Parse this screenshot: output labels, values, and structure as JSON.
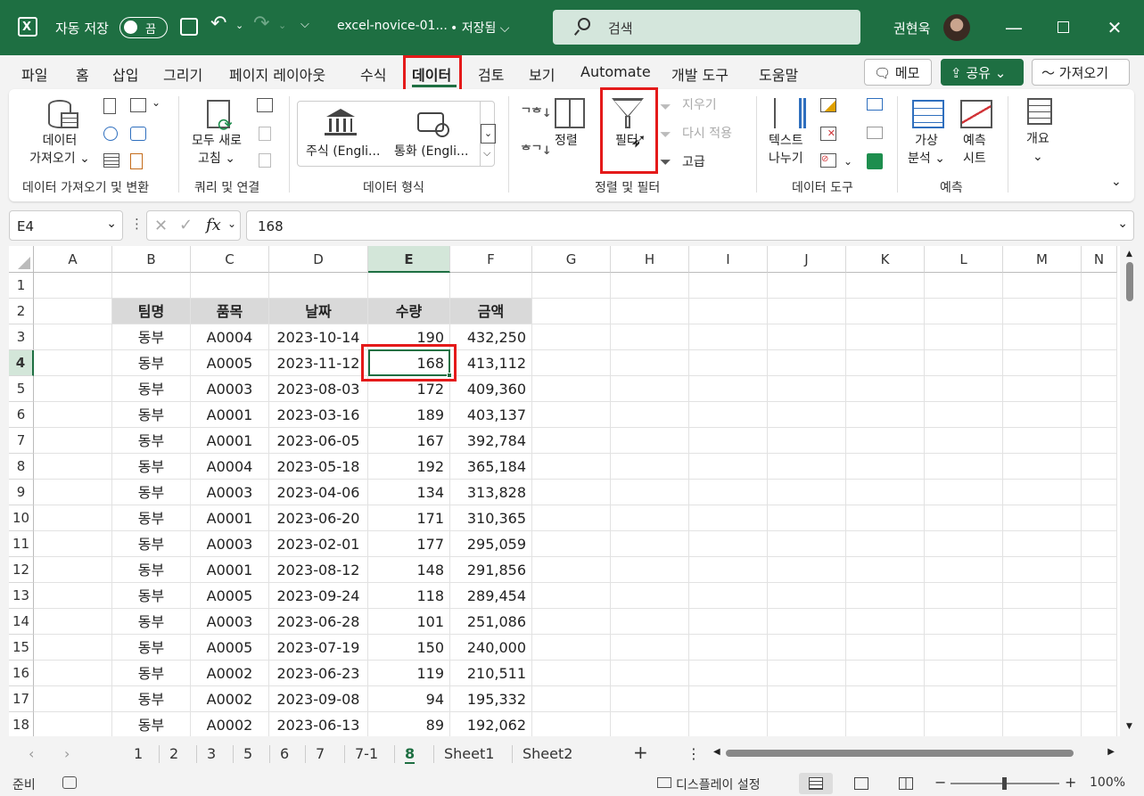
{
  "titlebar": {
    "autosave_label": "자동 저장",
    "autosave_state": "끔",
    "filename": "excel-novice-01...",
    "saved_status": "• 저장됨 ⌵",
    "search_placeholder": "검색",
    "user_name": "권현욱"
  },
  "tabs": [
    "파일",
    "홈",
    "삽입",
    "그리기",
    "페이지 레이아웃",
    "수식",
    "데이터",
    "검토",
    "보기",
    "Automate",
    "개발 도구",
    "도움말"
  ],
  "active_tab": "데이터",
  "tab_buttons": {
    "memo": "메모",
    "share": "공유",
    "share_caret": "⌄",
    "getfrom": "가져오기"
  },
  "ribbon": {
    "get_data": {
      "line1": "데이터",
      "line2": "가져오기 ⌄",
      "group": "데이터 가져오기 및 변환"
    },
    "refresh": {
      "line1": "모두 새로",
      "line2": "고침 ⌄",
      "group": "쿼리 및 연결"
    },
    "datatypes": {
      "stock": "주식 (Engli...",
      "currency": "통화 (Engli...",
      "group": "데이터 형식"
    },
    "sort": {
      "label": "정렬",
      "filter": "필터",
      "clear": "지우기",
      "reapply": "다시 적용",
      "advanced": "고급",
      "group": "정렬 및 필터"
    },
    "tools": {
      "line1": "텍스트",
      "line2": "나누기",
      "group": "데이터 도구"
    },
    "forecast": {
      "whatif1": "가상",
      "whatif2": "분석 ⌄",
      "sheet1": "예측",
      "sheet2": "시트",
      "group": "예측"
    },
    "outline": {
      "label": "개요",
      "caret": "⌄"
    }
  },
  "formula_bar": {
    "name_box": "E4",
    "value": "168"
  },
  "columns": [
    "A",
    "B",
    "C",
    "D",
    "E",
    "F",
    "G",
    "H",
    "I",
    "J",
    "K",
    "L",
    "M",
    "N"
  ],
  "headers": [
    "팀명",
    "품목",
    "날짜",
    "수량",
    "금액"
  ],
  "rows": [
    [
      "동부",
      "A0004",
      "2023-10-14",
      "190",
      "432,250"
    ],
    [
      "동부",
      "A0005",
      "2023-11-12",
      "168",
      "413,112"
    ],
    [
      "동부",
      "A0003",
      "2023-08-03",
      "172",
      "409,360"
    ],
    [
      "동부",
      "A0001",
      "2023-03-16",
      "189",
      "403,137"
    ],
    [
      "동부",
      "A0001",
      "2023-06-05",
      "167",
      "392,784"
    ],
    [
      "동부",
      "A0004",
      "2023-05-18",
      "192",
      "365,184"
    ],
    [
      "동부",
      "A0003",
      "2023-04-06",
      "134",
      "313,828"
    ],
    [
      "동부",
      "A0001",
      "2023-06-20",
      "171",
      "310,365"
    ],
    [
      "동부",
      "A0003",
      "2023-02-01",
      "177",
      "295,059"
    ],
    [
      "동부",
      "A0001",
      "2023-08-12",
      "148",
      "291,856"
    ],
    [
      "동부",
      "A0005",
      "2023-09-24",
      "118",
      "289,454"
    ],
    [
      "동부",
      "A0003",
      "2023-06-28",
      "101",
      "251,086"
    ],
    [
      "동부",
      "A0005",
      "2023-07-19",
      "150",
      "240,000"
    ],
    [
      "동부",
      "A0002",
      "2023-06-23",
      "119",
      "210,511"
    ],
    [
      "동부",
      "A0002",
      "2023-09-08",
      "94",
      "195,332"
    ],
    [
      "동부",
      "A0002",
      "2023-06-13",
      "89",
      "192,062"
    ]
  ],
  "row_numbers": [
    "1",
    "2",
    "3",
    "4",
    "5",
    "6",
    "7",
    "8",
    "9",
    "10",
    "11",
    "12",
    "13",
    "14",
    "15",
    "16",
    "17",
    "18"
  ],
  "sheet_tabs": [
    "1",
    "2",
    "3",
    "5",
    "6",
    "7",
    "7-1",
    "8",
    "Sheet1",
    "Sheet2"
  ],
  "active_sheet": "8",
  "status": {
    "ready": "준비",
    "display": "디스플레이 설정",
    "zoom": "100%"
  },
  "colors": {
    "excel_green": "#1e6f42",
    "highlight_red": "#e41a1a",
    "header_fill": "#d9d9d9"
  }
}
